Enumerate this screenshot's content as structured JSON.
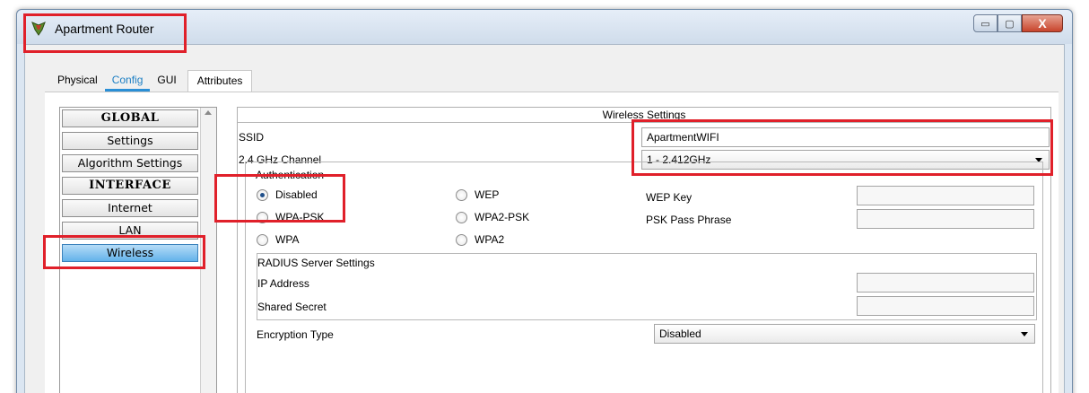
{
  "window": {
    "title": "Apartment Router",
    "min_symbol": "▭",
    "max_symbol": "▢",
    "close_symbol": "X"
  },
  "tabs": [
    {
      "label": "Physical"
    },
    {
      "label": "Config"
    },
    {
      "label": "GUI"
    },
    {
      "label": "Attributes"
    }
  ],
  "sidebar": {
    "items": [
      {
        "label": "GLOBAL"
      },
      {
        "label": "Settings"
      },
      {
        "label": "Algorithm Settings"
      },
      {
        "label": "INTERFACE"
      },
      {
        "label": "Internet"
      },
      {
        "label": "LAN"
      },
      {
        "label": "Wireless"
      }
    ]
  },
  "wireless": {
    "title": "Wireless Settings",
    "ssid_label": "SSID",
    "ssid_value": "ApartmentWIFI",
    "channel_label": "2.4 GHz Channel",
    "channel_value": "1 - 2.412GHz",
    "auth_label": "Authentication",
    "auth_options": [
      {
        "label": "Disabled",
        "checked": true
      },
      {
        "label": "WEP",
        "checked": false
      },
      {
        "label": "WPA-PSK",
        "checked": false
      },
      {
        "label": "WPA2-PSK",
        "checked": false
      },
      {
        "label": "WPA",
        "checked": false
      },
      {
        "label": "WPA2",
        "checked": false
      }
    ],
    "wep_key_label": "WEP Key",
    "psk_label": "PSK Pass Phrase",
    "radius": {
      "title": "RADIUS Server Settings",
      "ip_label": "IP Address",
      "secret_label": "Shared Secret"
    },
    "encryption_label": "Encryption Type",
    "encryption_value": "Disabled"
  },
  "colors": {
    "highlight": "#e0202a",
    "active_tab": "#1d7fc4",
    "active_sidebar": "#63b2ea"
  }
}
